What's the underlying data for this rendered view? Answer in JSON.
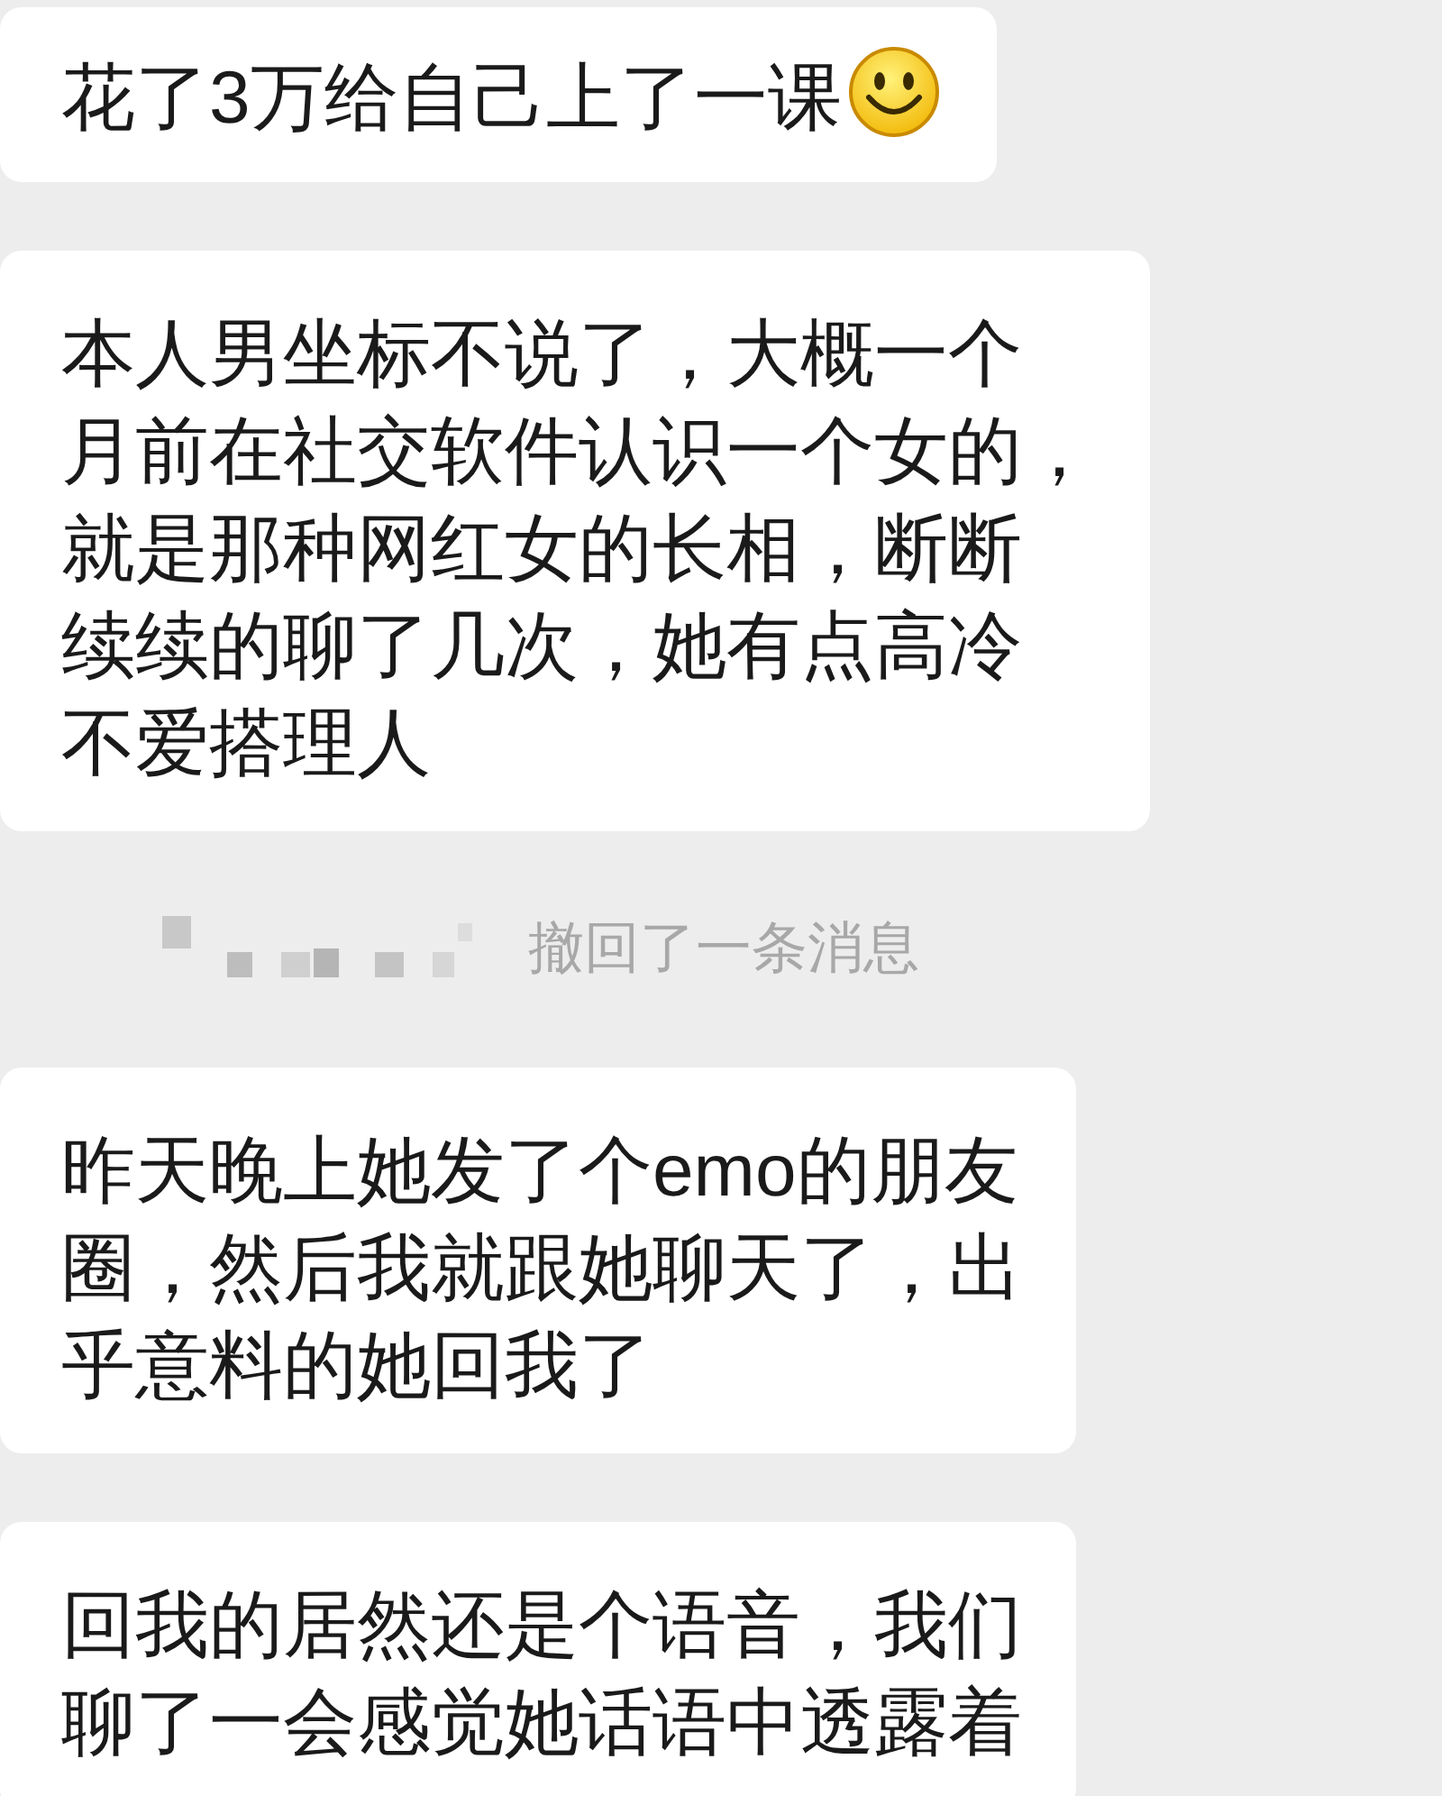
{
  "messages": [
    {
      "kind": "bubble",
      "lines": [
        "花了3万给自己上了一课"
      ],
      "smiley": true
    },
    {
      "kind": "bubble",
      "lines": [
        "本人男坐标不说了，大概一个",
        "月前在社交软件认识一个女的，",
        "就是那种网红女的长相，断断",
        "续续的聊了几次，她有点高冷",
        "不爱搭理人"
      ]
    },
    {
      "kind": "recall",
      "text": "撤回了一条消息"
    },
    {
      "kind": "bubble",
      "lines": [
        "昨天晚上她发了个emo的朋友",
        "圈，然后我就跟她聊天了，出",
        "乎意料的她回我了"
      ]
    },
    {
      "kind": "bubble",
      "lines": [
        "回我的居然还是个语音，我们",
        "聊了一会感觉她话语中透露着"
      ]
    }
  ]
}
